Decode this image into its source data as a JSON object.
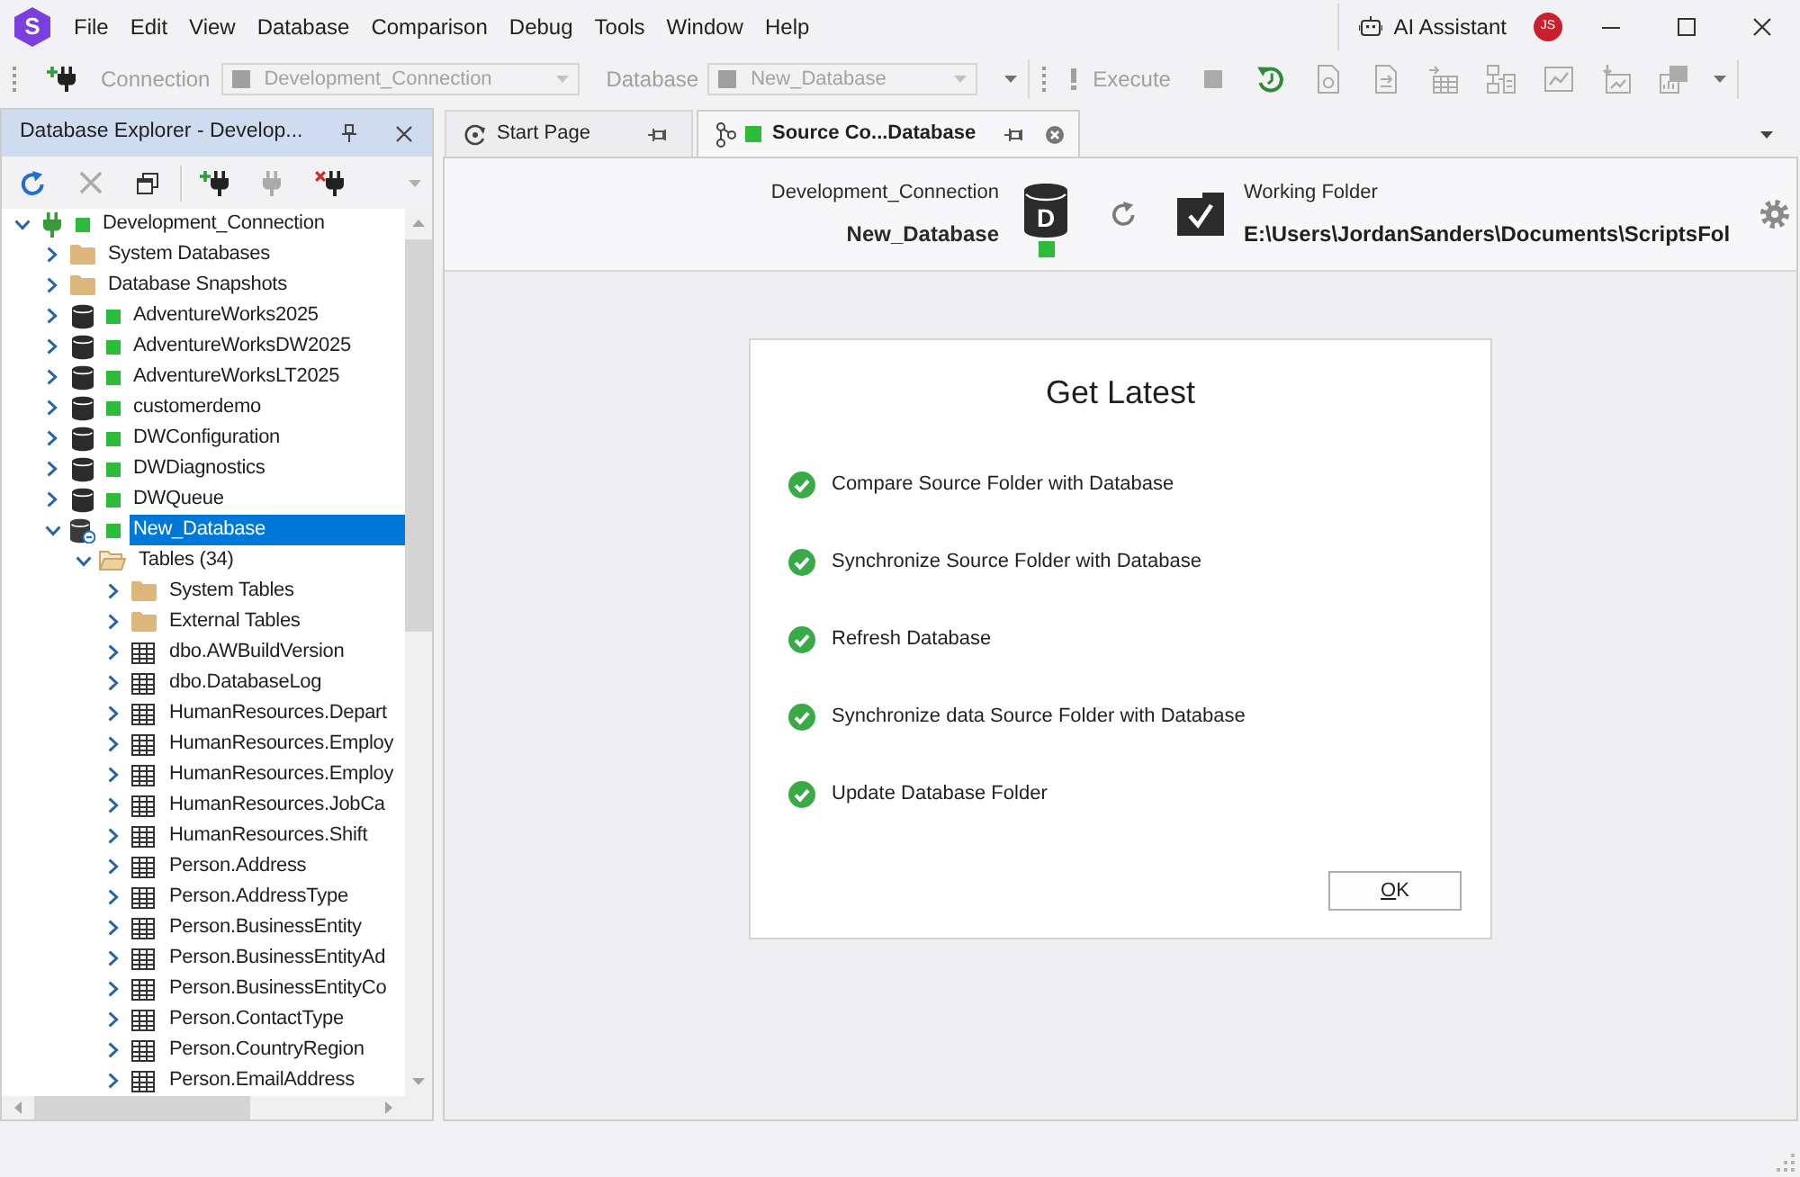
{
  "app": {
    "logo_text": "S"
  },
  "menu": [
    "File",
    "Edit",
    "View",
    "Database",
    "Comparison",
    "Debug",
    "Tools",
    "Window",
    "Help"
  ],
  "title_bar": {
    "assistant_label": "AI Assistant",
    "avatar_initials": "JS"
  },
  "toolbar": {
    "connection": {
      "label": "Connection",
      "value": "Development_Connection",
      "disabled": true
    },
    "database": {
      "label": "Database",
      "value": "New_Database",
      "disabled": true
    },
    "execute": {
      "label": "Execute",
      "disabled": true
    },
    "tools": [
      {
        "kind": "stop",
        "disabled": true
      },
      {
        "kind": "history",
        "disabled": false
      },
      {
        "kind": "document",
        "disabled": true
      },
      {
        "kind": "document-arrow",
        "disabled": true
      },
      {
        "kind": "table-arrow",
        "disabled": true
      },
      {
        "kind": "diagram",
        "disabled": true
      },
      {
        "kind": "chart",
        "disabled": true
      },
      {
        "kind": "chart-arrow",
        "disabled": true
      },
      {
        "kind": "stack",
        "disabled": true
      }
    ]
  },
  "explorer": {
    "title": "Database Explorer - Develop...",
    "tool_groups": [
      [
        {
          "kind": "refresh",
          "disabled": false
        },
        {
          "kind": "delete",
          "disabled": true
        },
        {
          "kind": "copy",
          "disabled": false
        }
      ],
      [
        {
          "kind": "add-connection",
          "disabled": false
        },
        {
          "kind": "plug",
          "disabled": true
        },
        {
          "kind": "remove-connection",
          "disabled": false
        }
      ]
    ],
    "tree": [
      {
        "label": "Development_Connection",
        "kind": "connection",
        "online": true,
        "expanded": true,
        "selected": false,
        "children": [
          {
            "label": "System Databases",
            "kind": "folder",
            "expanded": false,
            "selected": false
          },
          {
            "label": "Database Snapshots",
            "kind": "folder",
            "expanded": false,
            "selected": false
          },
          {
            "label": "AdventureWorks2025",
            "kind": "database",
            "online": true,
            "source_controlled": false,
            "expanded": false,
            "selected": false
          },
          {
            "label": "AdventureWorksDW2025",
            "kind": "database",
            "online": true,
            "source_controlled": false,
            "expanded": false,
            "selected": false
          },
          {
            "label": "AdventureWorksLT2025",
            "kind": "database",
            "online": true,
            "source_controlled": false,
            "expanded": false,
            "selected": false
          },
          {
            "label": "customerdemo",
            "kind": "database",
            "online": true,
            "source_controlled": false,
            "expanded": false,
            "selected": false
          },
          {
            "label": "DWConfiguration",
            "kind": "database",
            "online": true,
            "source_controlled": false,
            "expanded": false,
            "selected": false
          },
          {
            "label": "DWDiagnostics",
            "kind": "database",
            "online": true,
            "source_controlled": false,
            "expanded": false,
            "selected": false
          },
          {
            "label": "DWQueue",
            "kind": "database",
            "online": true,
            "source_controlled": false,
            "expanded": false,
            "selected": false
          },
          {
            "label": "New_Database",
            "kind": "database",
            "online": true,
            "source_controlled": true,
            "expanded": true,
            "selected": true,
            "children": [
              {
                "label": "Tables (34)",
                "kind": "folder",
                "expanded": true,
                "selected": false,
                "children": [
                  {
                    "label": "System Tables",
                    "kind": "folder",
                    "expanded": false,
                    "selected": false
                  },
                  {
                    "label": "External Tables",
                    "kind": "folder",
                    "expanded": false,
                    "selected": false
                  },
                  {
                    "label": "dbo.AWBuildVersion",
                    "kind": "table",
                    "expanded": false,
                    "selected": false
                  },
                  {
                    "label": "dbo.DatabaseLog",
                    "kind": "table",
                    "expanded": false,
                    "selected": false
                  },
                  {
                    "label": "HumanResources.Depart",
                    "kind": "table",
                    "expanded": false,
                    "selected": false
                  },
                  {
                    "label": "HumanResources.Employ",
                    "kind": "table",
                    "expanded": false,
                    "selected": false
                  },
                  {
                    "label": "HumanResources.Employ",
                    "kind": "table",
                    "expanded": false,
                    "selected": false
                  },
                  {
                    "label": "HumanResources.JobCa",
                    "kind": "table",
                    "expanded": false,
                    "selected": false
                  },
                  {
                    "label": "HumanResources.Shift",
                    "kind": "table",
                    "expanded": false,
                    "selected": false
                  },
                  {
                    "label": "Person.Address",
                    "kind": "table",
                    "expanded": false,
                    "selected": false
                  },
                  {
                    "label": "Person.AddressType",
                    "kind": "table",
                    "expanded": false,
                    "selected": false
                  },
                  {
                    "label": "Person.BusinessEntity",
                    "kind": "table",
                    "expanded": false,
                    "selected": false
                  },
                  {
                    "label": "Person.BusinessEntityAd",
                    "kind": "table",
                    "expanded": false,
                    "selected": false
                  },
                  {
                    "label": "Person.BusinessEntityCo",
                    "kind": "table",
                    "expanded": false,
                    "selected": false
                  },
                  {
                    "label": "Person.ContactType",
                    "kind": "table",
                    "expanded": false,
                    "selected": false
                  },
                  {
                    "label": "Person.CountryRegion",
                    "kind": "table",
                    "expanded": false,
                    "selected": false
                  },
                  {
                    "label": "Person.EmailAddress",
                    "kind": "table",
                    "expanded": false,
                    "selected": false
                  }
                ]
              }
            ]
          }
        ]
      }
    ]
  },
  "tabs": [
    {
      "label": "Start Page",
      "kind": "start",
      "selected": false
    },
    {
      "label": "Source Co...Database",
      "kind": "source-control",
      "online": true,
      "selected": true
    }
  ],
  "source_control": {
    "connection": "Development_Connection",
    "database": "New_Database",
    "database_icon_letter": "D",
    "online": true,
    "folder_label": "Working Folder",
    "folder_path": "E:\\Users\\JordanSanders\\Documents\\ScriptsFol"
  },
  "dialog": {
    "title": "Get Latest",
    "steps": [
      {
        "label": "Compare Source Folder with Database",
        "done": true
      },
      {
        "label": "Synchronize Source Folder with Database",
        "done": true
      },
      {
        "label": "Refresh Database",
        "done": true
      },
      {
        "label": "Synchronize data Source Folder with Database",
        "done": true
      },
      {
        "label": "Update Database Folder",
        "done": true
      }
    ],
    "button": "OK"
  }
}
